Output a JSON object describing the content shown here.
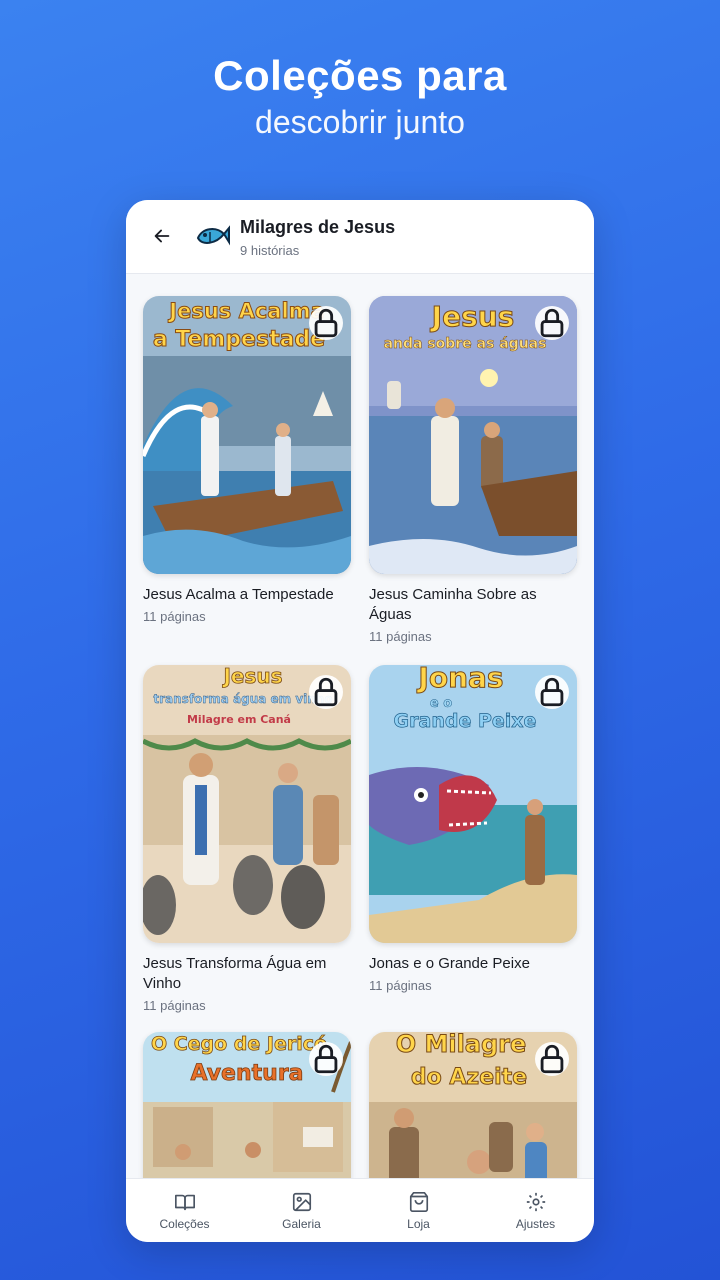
{
  "headline": {
    "line1": "Coleções para",
    "line2": "descobrir junto"
  },
  "collection": {
    "title": "Milagres de Jesus",
    "subtitle": "9 histórias"
  },
  "cards": [
    {
      "title": "Jesus Acalma a Tempestade",
      "pages": "11 páginas",
      "cover_line1": "Jesus Acalma",
      "cover_line2": "a Tempestade",
      "locked": true
    },
    {
      "title": "Jesus Caminha Sobre as Águas",
      "pages": "11 páginas",
      "cover_line1": "Jesus",
      "cover_line2": "anda sobre as águas",
      "locked": true
    },
    {
      "title": "Jesus Transforma Água em Vinho",
      "pages": "11 páginas",
      "cover_line1": "Jesus",
      "cover_line2": "transforma água em vinho",
      "cover_line3": "Milagre em Caná",
      "locked": true
    },
    {
      "title": "Jonas e o Grande Peixe",
      "pages": "11 páginas",
      "cover_line1": "Jonas",
      "cover_line2": "e o",
      "cover_line3": "Grande Peixe",
      "locked": true
    },
    {
      "title": "",
      "pages": "",
      "cover_line1": "O Cego de Jericó",
      "cover_line2": "Aventura",
      "locked": true
    },
    {
      "title": "",
      "pages": "",
      "cover_line1": "O Milagre",
      "cover_line2": "do Azeite",
      "locked": true
    }
  ],
  "nav": [
    {
      "label": "Coleções",
      "icon": "book-icon"
    },
    {
      "label": "Galeria",
      "icon": "image-icon"
    },
    {
      "label": "Loja",
      "icon": "shopping-bag-icon"
    },
    {
      "label": "Ajustes",
      "icon": "gear-icon"
    }
  ]
}
